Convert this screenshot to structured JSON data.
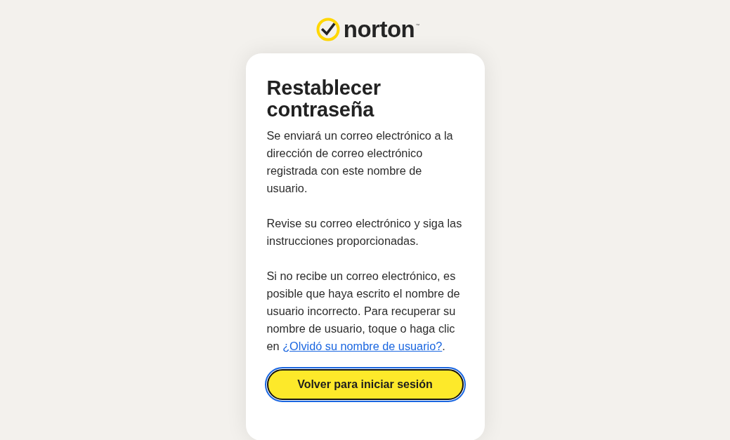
{
  "header": {
    "logo_text": "norton",
    "trademark": "™"
  },
  "card": {
    "title": "Restablecer contraseña",
    "paragraphs": [
      {
        "text": "Se enviará un correo electrónico a la dirección de correo electrónico registrada con este nombre de usuario."
      },
      {
        "text": "Revise su correo electrónico y siga las instrucciones proporcionadas."
      },
      {
        "text": "Si no recibe un correo electrónico, es posible que haya escrito el nombre de usuario incorrecto. Para recuperar su nombre de usuario, toque o haga clic en",
        "link": "¿Olvidó su nombre de usuario?",
        "after": "."
      }
    ],
    "button": {
      "label": "Volver para iniciar sesión",
      "focused": true
    }
  }
}
